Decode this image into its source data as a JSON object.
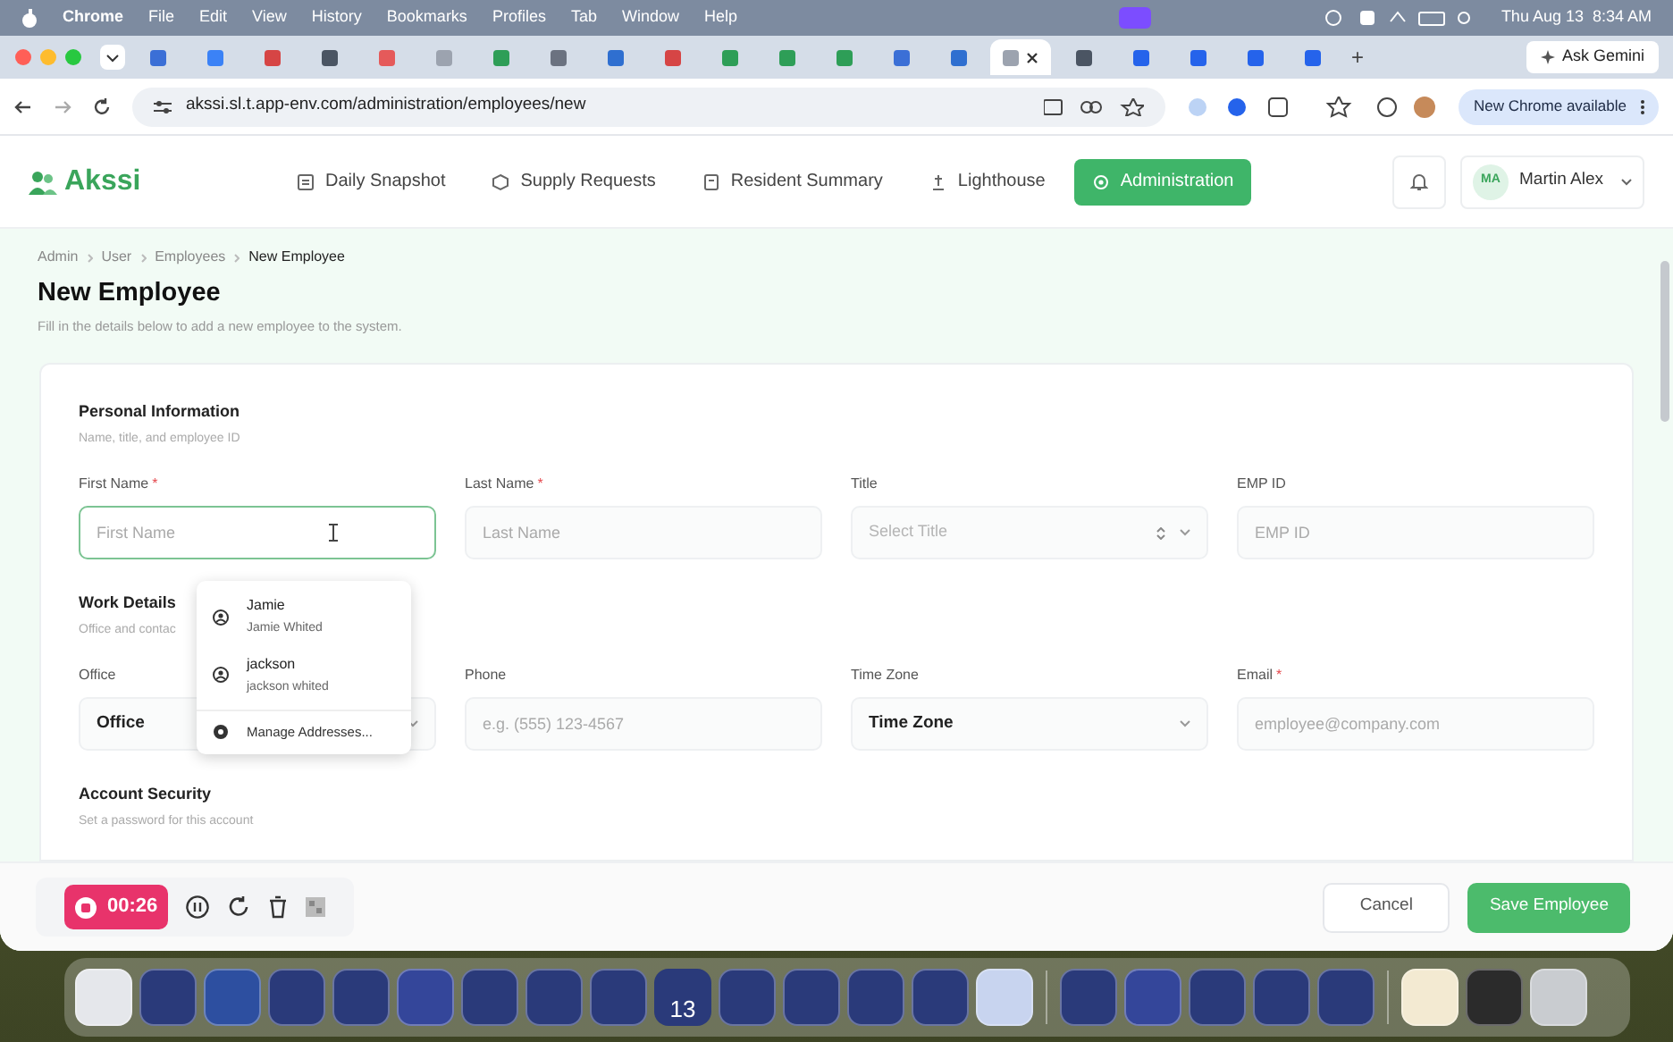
{
  "menu_bar": {
    "app": "Chrome",
    "items": [
      "File",
      "Edit",
      "View",
      "History",
      "Bookmarks",
      "Profiles",
      "Tab",
      "Window",
      "Help"
    ],
    "clock": "Thu Aug 13  8:34 AM"
  },
  "browser": {
    "tabs": [
      {
        "selected": false
      },
      {
        "selected": false
      },
      {
        "selected": false
      },
      {
        "selected": false
      },
      {
        "selected": false
      },
      {
        "selected": false
      },
      {
        "selected": false
      },
      {
        "selected": false
      },
      {
        "selected": false
      },
      {
        "selected": false
      },
      {
        "selected": false
      },
      {
        "selected": false
      },
      {
        "selected": false
      },
      {
        "selected": false
      },
      {
        "selected": false
      },
      {
        "selected": true
      },
      {
        "selected": false
      },
      {
        "selected": false
      },
      {
        "selected": false
      },
      {
        "selected": false
      },
      {
        "selected": false
      }
    ],
    "new_tab": "+",
    "ask_button": "Ask Gemini",
    "url": "akssi.sl.t.app-env.com/administration/employees/new",
    "update_button": "New Chrome available"
  },
  "app_header": {
    "logo": "Akssi",
    "nav": [
      {
        "label": "Daily Snapshot",
        "selected": false
      },
      {
        "label": "Supply Requests",
        "selected": false
      },
      {
        "label": "Resident Summary",
        "selected": false
      },
      {
        "label": "Lighthouse",
        "selected": false
      },
      {
        "label": "Administration",
        "selected": true
      }
    ],
    "user": {
      "initials": "MA",
      "name": "Martin Alex"
    }
  },
  "breadcrumb": [
    "Admin",
    "User",
    "Employees",
    "New Employee"
  ],
  "page": {
    "title": "New Employee",
    "subtitle": "Fill in the details below to add a new employee to the system."
  },
  "sections": [
    {
      "title": "Personal Information",
      "subtitle": "Name, title, and employee ID",
      "fields": [
        {
          "kind": "input",
          "label": "First Name",
          "required_mark": "*",
          "placeholder": "First Name",
          "focused": true
        },
        {
          "kind": "input",
          "label": "Last Name",
          "required_mark": "*",
          "placeholder": "Last Name",
          "focused": false
        },
        {
          "kind": "select",
          "label": "Title",
          "placeholder": "Select Title",
          "focused": false
        },
        {
          "kind": "input",
          "label": "EMP ID",
          "placeholder": "EMP ID",
          "focused": false
        }
      ]
    },
    {
      "title": "Work Details",
      "subtitle": "Office and contac",
      "fields": [
        {
          "kind": "select",
          "label": "Office",
          "value": "Office",
          "focused": false
        },
        {
          "kind": "input",
          "label": "Phone",
          "placeholder": "e.g. (555) 123-4567",
          "focused": false
        },
        {
          "kind": "select",
          "label": "Time Zone",
          "value": "Time Zone",
          "focused": false
        },
        {
          "kind": "input",
          "label": "Email",
          "required_mark": "*",
          "placeholder": "employee@company.com",
          "focused": false
        }
      ]
    },
    {
      "title": "Account Security",
      "subtitle": "Set a password for this account"
    }
  ],
  "autofill": {
    "suggestions": [
      {
        "name": "Jamie",
        "detail": "Jamie Whited"
      },
      {
        "name": "jackson",
        "detail": "jackson whited"
      }
    ],
    "manage": "Manage Addresses..."
  },
  "recorder": {
    "time": "00:26"
  },
  "footer": {
    "cancel": "Cancel",
    "save": "Save Employee"
  },
  "dock": {
    "calendar_day": "13"
  }
}
